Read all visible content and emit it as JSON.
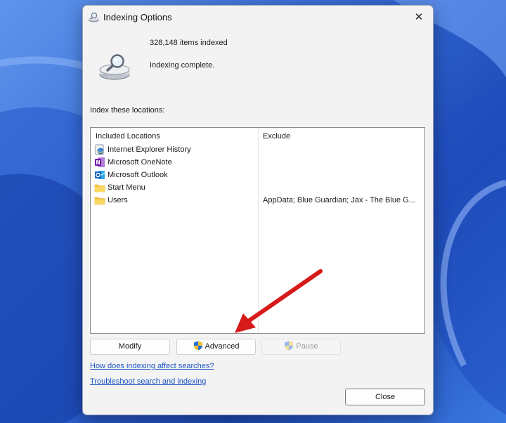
{
  "window": {
    "title": "Indexing Options",
    "close_glyph": "✕"
  },
  "summary": {
    "items_indexed": "328,148 items indexed",
    "status": "Indexing complete."
  },
  "locations": {
    "label": "Index these locations:",
    "columns": {
      "included": "Included Locations",
      "exclude": "Exclude"
    },
    "rows": [
      {
        "label": "Internet Explorer History",
        "exclude": "",
        "icon": "ie-history-icon"
      },
      {
        "label": "Microsoft OneNote",
        "exclude": "",
        "icon": "onenote-icon"
      },
      {
        "label": "Microsoft Outlook",
        "exclude": "",
        "icon": "outlook-icon"
      },
      {
        "label": "Start Menu",
        "exclude": "",
        "icon": "folder-icon"
      },
      {
        "label": "Users",
        "exclude": "AppData; Blue Guardian; Jax - The Blue G...",
        "icon": "folder-icon"
      }
    ]
  },
  "buttons": {
    "modify": "Modify",
    "advanced": "Advanced",
    "pause": "Pause",
    "close": "Close"
  },
  "links": {
    "how": "How does indexing affect searches?",
    "troubleshoot": "Troubleshoot search and indexing"
  },
  "colors": {
    "link": "#1c56c4",
    "annotation_arrow": "#d61a1a",
    "dialog_bg": "#f3f3f3"
  }
}
